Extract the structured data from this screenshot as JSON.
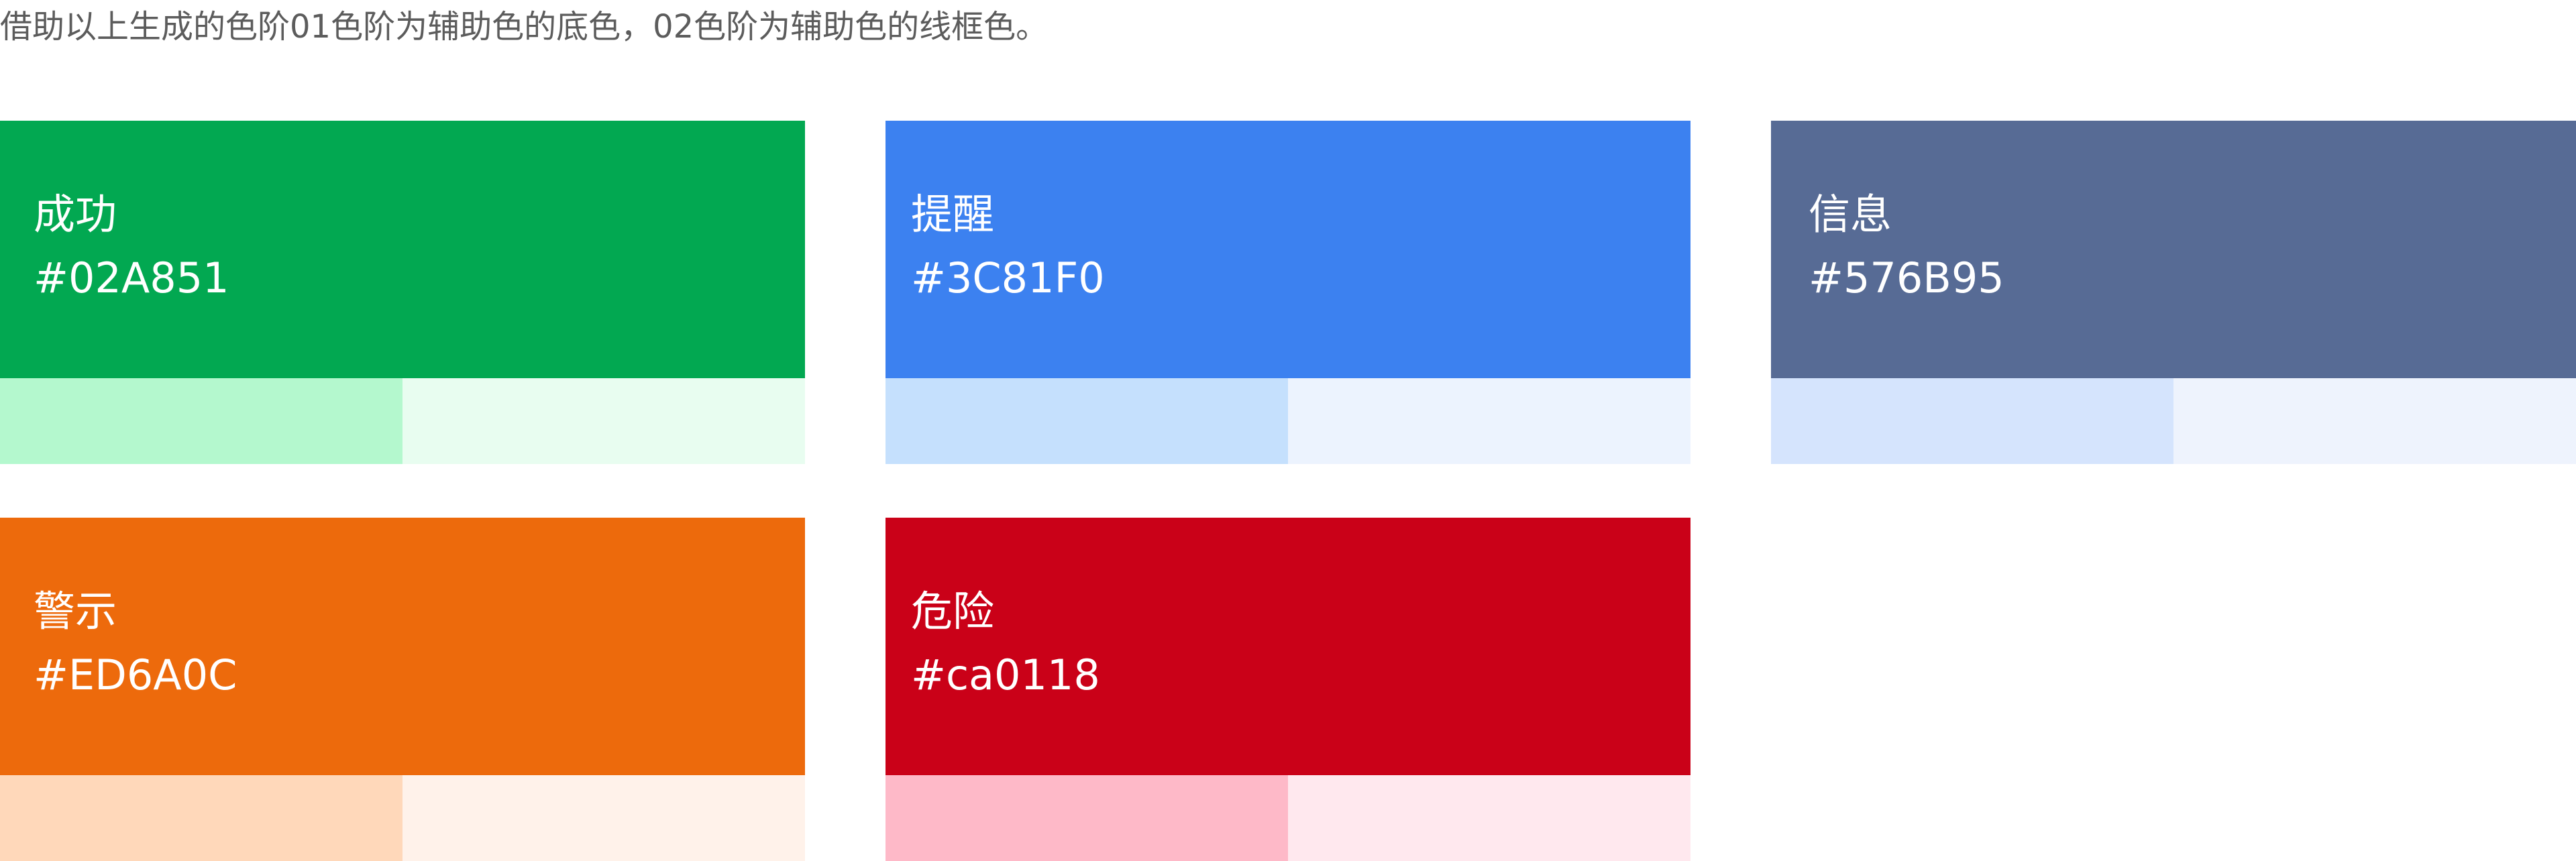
{
  "intro": "借助以上生成的色阶01色阶为辅助色的底色，02色阶为辅助色的线框色。",
  "cards": {
    "success": {
      "name": "成功",
      "hex": "#02A851",
      "color": "#02A851",
      "step01": "#B4F8CE",
      "step02": "#E8FDF0"
    },
    "reminder": {
      "name": "提醒",
      "hex": "#3C81F0",
      "color": "#3C81F0",
      "step01": "#C5E0FD",
      "step02": "#ECF3FE"
    },
    "info": {
      "name": "信息",
      "hex": "#576B95",
      "color": "#576B95",
      "step01": "#D5E4FD",
      "step02": "#EEF3FD"
    },
    "warning": {
      "name": "警示",
      "hex": "#ED6A0C",
      "color": "#ED6A0C",
      "step01": "#FFD8BA",
      "step02": "#FFF2EA"
    },
    "danger": {
      "name": "危险",
      "hex": "#ca0118",
      "color": "#CA0118",
      "step01": "#FEB9C8",
      "step02": "#FFE8EE"
    }
  }
}
